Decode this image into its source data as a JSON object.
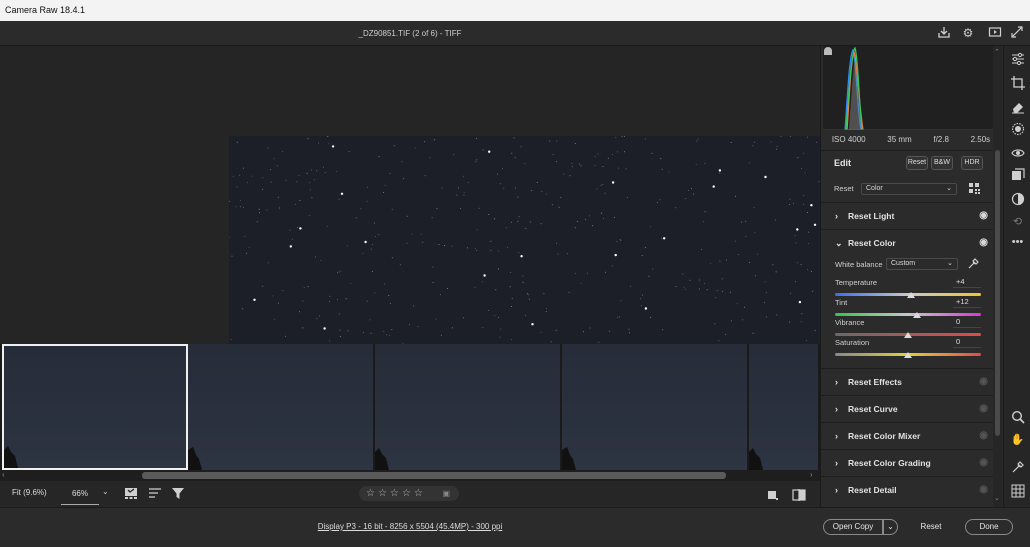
{
  "app": {
    "title": "Camera Raw 18.4.1"
  },
  "header": {
    "filename": "_DZ90851.TIF (2 of 6)  -  TIFF"
  },
  "filmstrip": {
    "count": 5,
    "selected_index": 0
  },
  "bottombar": {
    "fit_label": "Fit (9.6%)",
    "zoom_value": "66%",
    "stars": "☆☆☆☆☆"
  },
  "status": {
    "image_info": "Display P3 - 16 bit - 8256 x 5504 (45.4MP) - 300 ppi",
    "open_copy": "Open Copy",
    "reset": "Reset",
    "done": "Done"
  },
  "info": {
    "iso": "ISO 4000",
    "focal": "35 mm",
    "aperture": "f/2.8",
    "shutter": "2.50s"
  },
  "edit": {
    "title": "Edit",
    "reset_btn": "Reset",
    "bw_btn": "B&W",
    "hdr_btn": "HDR",
    "profile_label": "Reset",
    "profile_value": "Color"
  },
  "sections": {
    "light": "Reset Light",
    "color": "Reset Color",
    "effects": "Reset Effects",
    "curve": "Reset Curve",
    "mixer": "Reset Color Mixer",
    "grading": "Reset Color Grading",
    "detail": "Reset Detail"
  },
  "color_panel": {
    "wb_label": "White balance",
    "wb_value": "Custom",
    "sliders": [
      {
        "label": "Temperature",
        "value": "+4",
        "level": 0.52
      },
      {
        "label": "Tint",
        "value": "+12",
        "level": 0.56
      },
      {
        "label": "Vibrance",
        "value": "0",
        "level": 0.5
      },
      {
        "label": "Saturation",
        "value": "0",
        "level": 0.5
      }
    ]
  }
}
